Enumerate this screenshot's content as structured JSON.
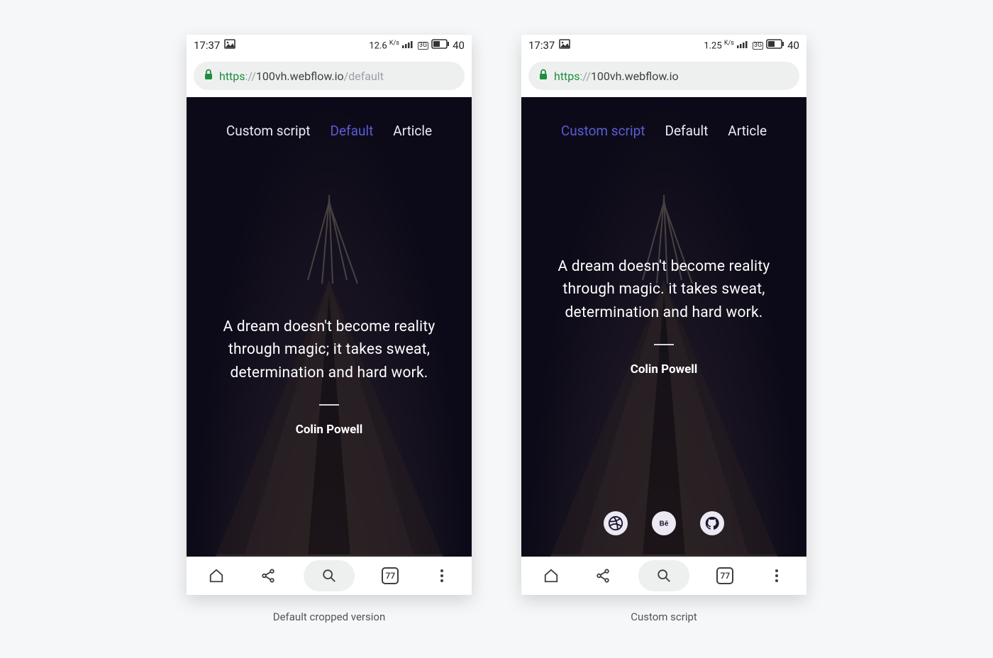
{
  "phones": [
    {
      "id": "default",
      "caption": "Default cropped version",
      "status": {
        "time": "17:37",
        "speed": "12.6",
        "speed_unit": "K/s",
        "battery": "40"
      },
      "url": {
        "scheme": "https",
        "host": "100vh.webflow.io",
        "path": "/default"
      },
      "nav": [
        {
          "label": "Custom script",
          "active": false
        },
        {
          "label": "Default",
          "active": true
        },
        {
          "label": "Article",
          "active": false
        }
      ],
      "quote": "A dream doesn't become reality through magic; it takes sweat, determination and hard work.",
      "author": "Colin Powell",
      "show_social": false,
      "tabs_count": "77"
    },
    {
      "id": "custom",
      "caption": "Custom script",
      "status": {
        "time": "17:37",
        "speed": "1.25",
        "speed_unit": "K/s",
        "battery": "40"
      },
      "url": {
        "scheme": "https",
        "host": "100vh.webflow.io",
        "path": ""
      },
      "nav": [
        {
          "label": "Custom script",
          "active": true
        },
        {
          "label": "Default",
          "active": false
        },
        {
          "label": "Article",
          "active": false
        }
      ],
      "quote": "A dream doesn't become reality through magic. it takes sweat, determination and hard work.",
      "author": "Colin Powell",
      "show_social": true,
      "social": [
        "dribbble",
        "behance",
        "github"
      ],
      "tabs_count": "77"
    }
  ]
}
